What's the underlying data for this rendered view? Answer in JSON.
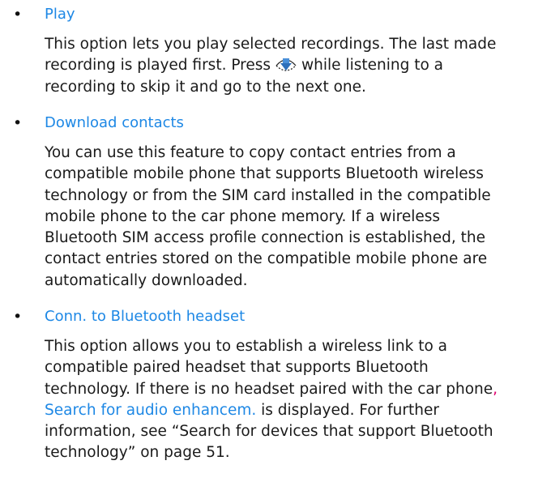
{
  "sections": [
    {
      "title": "Play",
      "lines": [
        "This option lets you play selected recordings. The last made",
        "recording is played first. Press",
        "while listening to a",
        "recording to skip it and go to the next one."
      ]
    },
    {
      "title": "Download contacts",
      "lines": [
        "You can use this feature to copy contact entries from a",
        "compatible mobile phone that supports Bluetooth wireless",
        "technology or from the SIM card installed in the compatible",
        "mobile phone to the car phone memory. If a wireless",
        "Bluetooth SIM access profile connection is established, the",
        "contact entries stored on the compatible mobile phone are",
        "automatically downloaded."
      ]
    },
    {
      "title": "Conn. to Bluetooth headset",
      "lines": [
        "This option allows you to establish a wireless link to a",
        "compatible paired headset that supports Bluetooth",
        "technology. If there is no headset paired with the car phone",
        "Search for audio enhancem.",
        "is displayed. For further",
        "information, see “Search for devices that support Bluetooth",
        "technology” on page 51."
      ]
    }
  ],
  "symbols": {
    "bullet": "•",
    "comma": ","
  },
  "icons": {
    "scroll_down": "scroll-down-icon"
  },
  "colors": {
    "link": "#1e88e5",
    "text": "#1a1a1a",
    "comma": "#e0006e"
  }
}
